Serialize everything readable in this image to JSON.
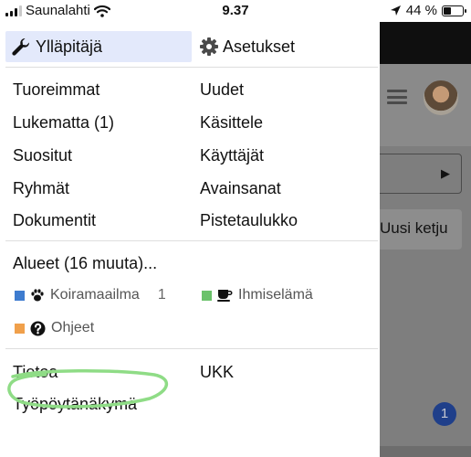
{
  "status_bar": {
    "carrier": "Saunalahti",
    "time": "9.37",
    "battery_percent": "44 %",
    "battery_level": 0.44
  },
  "menu": {
    "top": {
      "admin_label": "Ylläpitäjä",
      "settings_label": "Asetukset"
    },
    "links": {
      "latest": "Tuoreimmat",
      "new": "Uudet",
      "unread": "Lukematta (1)",
      "review": "Käsittele",
      "top": "Suositut",
      "users": "Käyttäjät",
      "groups": "Ryhmät",
      "tags": "Avainsanat",
      "docs": "Dokumentit",
      "leaderboard": "Pistetaulukko"
    },
    "categories": {
      "header": "Alueet (16 muuta)...",
      "items": [
        {
          "name": "Koiramaailma",
          "count": "1",
          "color": "#3e7ccf",
          "icon": "paw-icon"
        },
        {
          "name": "Ihmiselämä",
          "color": "#6bc26b",
          "icon": "coffee-icon"
        },
        {
          "name": "Ohjeet",
          "color": "#f0a04b",
          "icon": "question-circle-icon"
        }
      ]
    },
    "footer": {
      "about": "Tietoa",
      "faq": "UKK",
      "desktop_view": "Työpöytänäkymä"
    }
  },
  "background_page": {
    "button_label": "Uusi ketju",
    "badge_count": "1"
  },
  "colors": {
    "active_item_bg": "#e3e9fb",
    "annotation_scribble": "#8fdc86",
    "badge": "#1f3f8a"
  }
}
